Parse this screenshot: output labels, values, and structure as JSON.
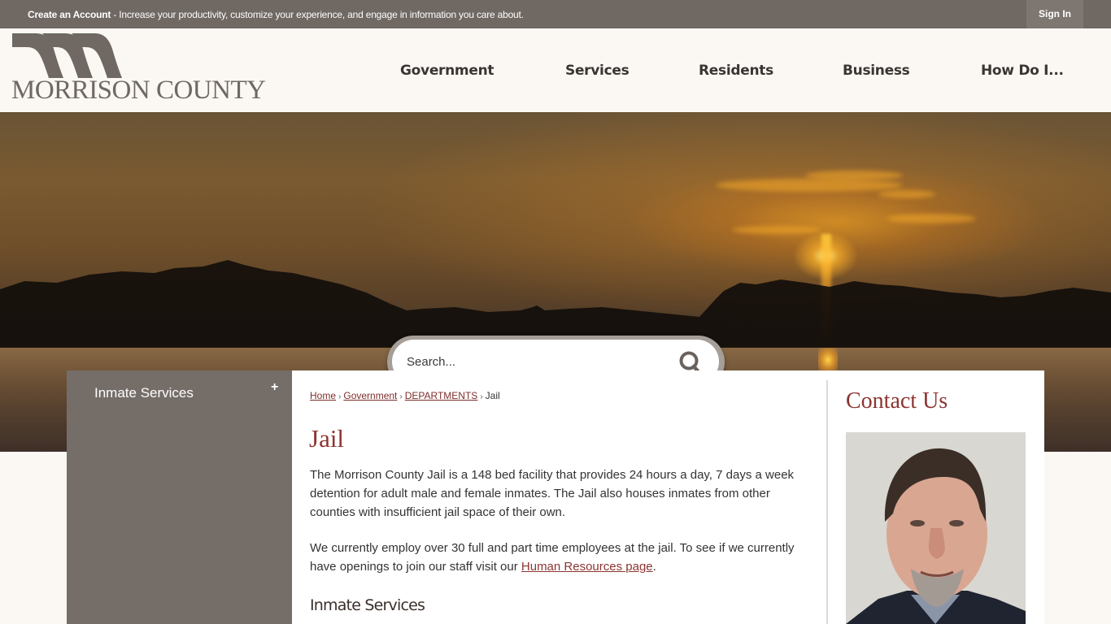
{
  "topbar": {
    "promo_bold": "Create an Account",
    "promo_text": " - Increase your productivity, customize your experience, and engage in information you care about.",
    "signin_label": "Sign In"
  },
  "header": {
    "logo_text": "MORRISON COUNTY",
    "nav": [
      {
        "label": "Government"
      },
      {
        "label": "Services"
      },
      {
        "label": "Residents"
      },
      {
        "label": "Business"
      },
      {
        "label": "How Do I..."
      }
    ]
  },
  "search": {
    "placeholder": "Search...",
    "icon": "search-icon"
  },
  "sidebar": {
    "items": [
      {
        "label": "Inmate Services",
        "expand_icon": "+"
      }
    ]
  },
  "breadcrumb": {
    "items": [
      "Home",
      "Government",
      "DEPARTMENTS"
    ],
    "current": "Jail",
    "separator": "›"
  },
  "main": {
    "title": "Jail",
    "paragraph1": "The Morrison County Jail is a 148 bed facility that provides 24 hours a day, 7 days a week detention for adult male and female inmates. The Jail also houses inmates from other counties with insufficient jail space of their own.",
    "paragraph2_before": "We currently employ over 30 full and part time employees at the jail. To see if we currently have openings to join our staff visit our ",
    "paragraph2_link": "Human Resources page",
    "paragraph2_after": ".",
    "subheading": "Inmate Services"
  },
  "contact": {
    "title": "Contact Us",
    "photo_alt": "Staff contact photo"
  },
  "colors": {
    "topbar": "#6f6863",
    "accent": "#8c3431",
    "sidebar": "#756d68",
    "background": "#fbf8f4"
  }
}
